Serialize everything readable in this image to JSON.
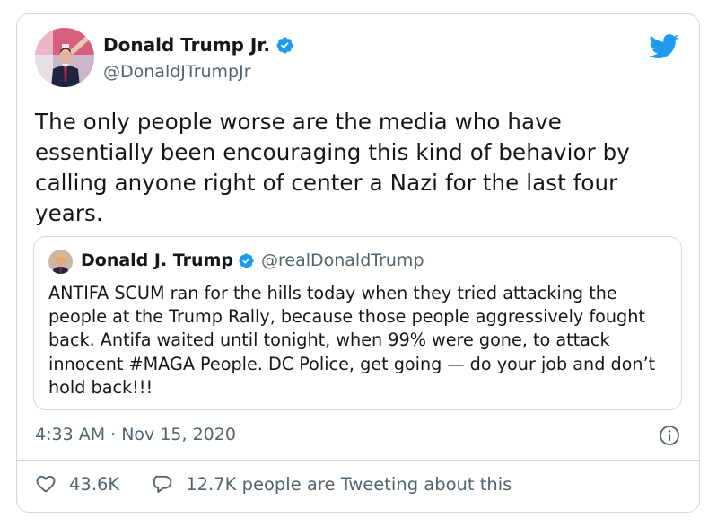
{
  "tweet": {
    "author": {
      "name": "Donald Trump Jr.",
      "handle": "@DonaldJTrumpJr",
      "verified": true
    },
    "text": "The only people worse are the media who have essentially been encouraging this kind of behavior by calling anyone right of center a Nazi for the last four years.",
    "quoted": {
      "name": "Donald J. Trump",
      "handle": "@realDonaldTrump",
      "verified": true,
      "text": "ANTIFA SCUM ran for the hills today when they tried attacking the people at the Trump Rally, because those people aggressively fought back. Antifa waited until tonight, when 99% were gone, to attack innocent #MAGA People. DC Police, get going — do your job and don’t hold back!!!"
    },
    "timestamp": "4:33 AM · Nov 15, 2020",
    "likes": "43.6K",
    "conversation": "12.7K people are Tweeting about this"
  },
  "colors": {
    "brand": "#1d9bf0",
    "text": "#14171a",
    "secondary": "#536471",
    "border": "#cfd9de"
  },
  "icons": {
    "brand": "twitter-bird-icon",
    "verified": "verified-badge-icon",
    "info": "info-icon",
    "like": "heart-icon",
    "conversation": "speech-bubble-icon"
  }
}
